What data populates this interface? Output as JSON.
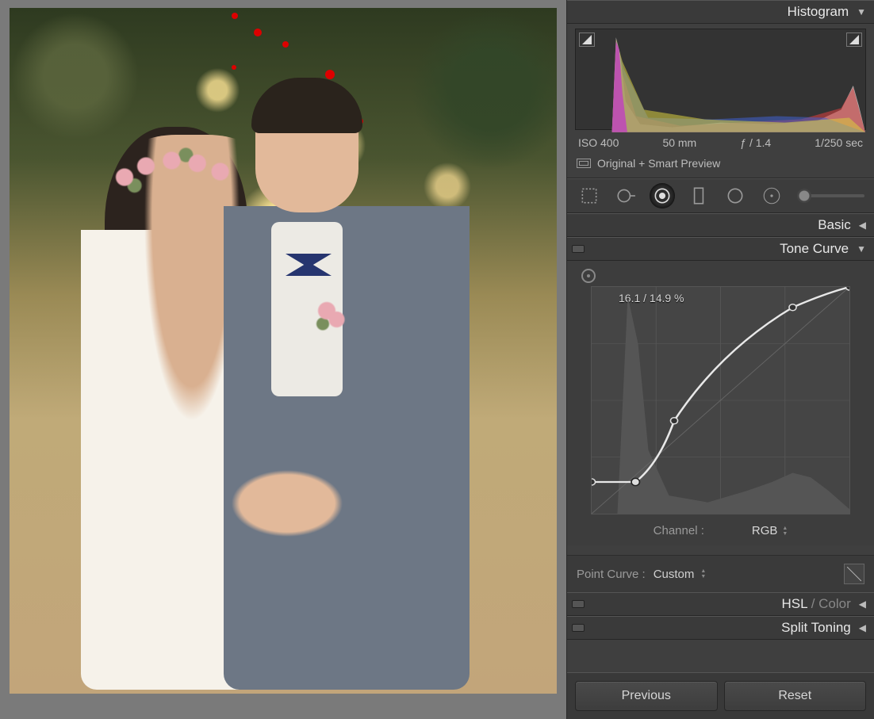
{
  "panels": {
    "histogram_label": "Histogram",
    "basic_label": "Basic",
    "tone_curve_label": "Tone Curve",
    "hsl_label_prefix": "HSL",
    "hsl_label_sep": " / ",
    "hsl_label_suffix": "Color",
    "split_toning_label": "Split Toning"
  },
  "exif": {
    "iso": "ISO 400",
    "focal": "50 mm",
    "aperture": "ƒ / 1.4",
    "shutter": "1/250 sec"
  },
  "preview_status": "Original + Smart Preview",
  "tone_curve": {
    "readout": "16.1 / 14.9 %",
    "channel_label": "Channel :",
    "channel_value": "RGB",
    "point_curve_label": "Point Curve :",
    "point_curve_value": "Custom",
    "points": [
      {
        "x": 0.0,
        "y": 0.14
      },
      {
        "x": 0.17,
        "y": 0.14
      },
      {
        "x": 0.32,
        "y": 0.41
      },
      {
        "x": 0.78,
        "y": 0.91
      },
      {
        "x": 1.0,
        "y": 1.0
      }
    ]
  },
  "buttons": {
    "previous": "Previous",
    "reset": "Reset"
  }
}
